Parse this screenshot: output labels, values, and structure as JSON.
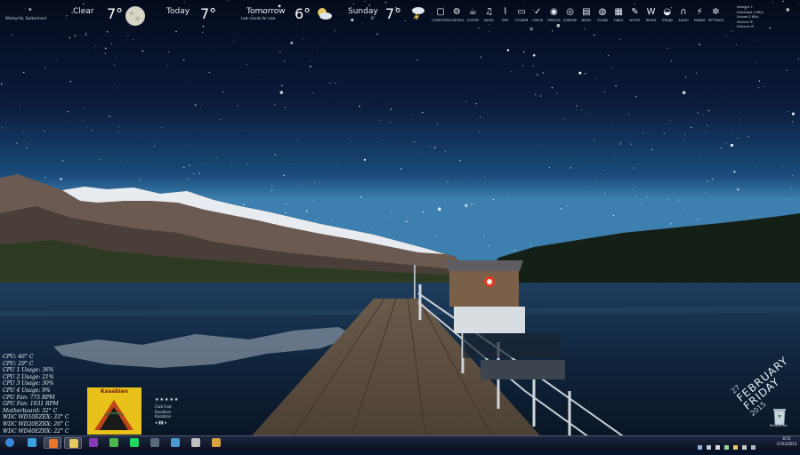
{
  "weather": {
    "current": {
      "condition": "Clear",
      "location_text": "Wieleyrtik, Switzerland",
      "temp": "7°",
      "icon": "moon-icon"
    },
    "today": {
      "label": "Today",
      "temp": "7°",
      "icon": "night-icon"
    },
    "tomorrow": {
      "label": "Tomorrow",
      "sub": "Low clouds for now",
      "temp": "6°",
      "icon": "partly-cloudy-icon"
    },
    "sunday": {
      "label": "Sunday",
      "sub": "8°",
      "temp": "7°",
      "icon": "storm-icon"
    }
  },
  "launcher": {
    "items": [
      {
        "label": "COMPUTER",
        "icon": "computer-icon"
      },
      {
        "label": "CONTROL",
        "icon": "settings-icon"
      },
      {
        "label": "COFFEE",
        "icon": "cup-icon"
      },
      {
        "label": "MUSIC",
        "icon": "music-icon"
      },
      {
        "label": "PIPE",
        "icon": "pipe-icon"
      },
      {
        "label": "FOLDER",
        "icon": "folder-icon"
      },
      {
        "label": "CHECK",
        "icon": "check-icon"
      },
      {
        "label": "FIREFOX",
        "icon": "firefox-icon"
      },
      {
        "label": "CHROME",
        "icon": "chrome-icon"
      },
      {
        "label": "NEWS",
        "icon": "news-icon"
      },
      {
        "label": "GLOBE",
        "icon": "globe-icon"
      },
      {
        "label": "TABLE",
        "icon": "table-icon"
      },
      {
        "label": "NOTES",
        "icon": "notes-icon"
      },
      {
        "label": "WORD",
        "icon": "word-icon"
      },
      {
        "label": "STEAM",
        "icon": "steam-icon"
      },
      {
        "label": "AUDIO",
        "icon": "headphones-icon"
      },
      {
        "label": "POWER",
        "icon": "lightning-icon"
      },
      {
        "label": "SETTINGS",
        "icon": "gear-icon"
      }
    ]
  },
  "corner": {
    "lines": [
      "Network 1",
      "Download 0 KB/s",
      "Upload 0 KB/s",
      "Internal IP",
      "External IP"
    ]
  },
  "hardware": {
    "lines": [
      "CPU: 46° C",
      "CPU: 29° C",
      "CPU 1 Usage: 36%",
      "CPU 2 Usage: 21%",
      "CPU 3 Usage: 30%",
      "CPU 4 Usage: 9%",
      "CPU Fan: 775 RPM",
      "GPU Fan: 1031 RPM",
      "Motherboard: 32° C",
      "WDC WD10EZEX: 33° C",
      "WDC WD20EZRX: 26° C",
      "WDC WD40EZRX: 22° C"
    ]
  },
  "music": {
    "album_title": "Kasabian",
    "rating": "★★★★★",
    "track_lines": [
      "Club Foot",
      "Kasabian",
      "Kasabian"
    ],
    "controls": "◂  ▮▮  ▸"
  },
  "date": {
    "day_number": "27",
    "month": "FEBRUARY",
    "weekday": "FRIDAY",
    "year": "2015"
  },
  "desktop": {
    "recycle_label": "Recycle Bin"
  },
  "taskbar": {
    "apps": [
      {
        "name": "start",
        "icon": "windows-start-icon",
        "active": false
      },
      {
        "name": "ie",
        "icon": "internet-explorer-icon",
        "active": false
      },
      {
        "name": "firefox",
        "icon": "firefox-icon",
        "active": true
      },
      {
        "name": "explorer",
        "icon": "folder-icon",
        "active": true
      },
      {
        "name": "onenote",
        "icon": "onenote-icon",
        "active": false
      },
      {
        "name": "sync",
        "icon": "refresh-icon",
        "active": false
      },
      {
        "name": "spotify",
        "icon": "spotify-icon",
        "active": false
      },
      {
        "name": "steam",
        "icon": "steam-icon",
        "active": false
      },
      {
        "name": "photos",
        "icon": "image-icon",
        "active": false
      },
      {
        "name": "media",
        "icon": "media-player-icon",
        "active": false
      },
      {
        "name": "tools",
        "icon": "tools-icon",
        "active": false
      }
    ],
    "clock_time": "8:55",
    "clock_date": "27/02/2015"
  },
  "colors": {
    "sky_top": "#050d20",
    "sky_horizon": "#1a4a7a",
    "lake": "#17304d",
    "accent": "#e8c11a"
  }
}
